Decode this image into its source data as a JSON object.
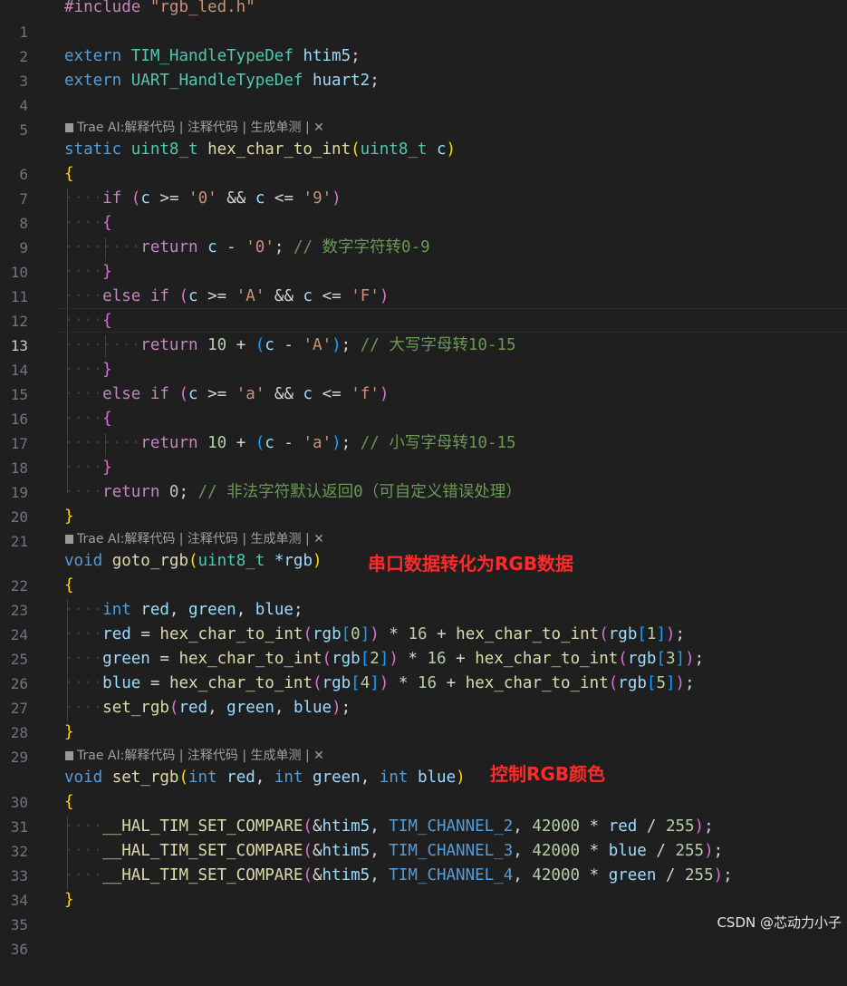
{
  "editor": {
    "theme_background": "#1f1f1f",
    "active_line": 13,
    "code_lens": "Trae AI:解释代码 | 注释代码 | 生成单测 | ✕",
    "line_numbers": [
      "1",
      "2",
      "3",
      "4",
      "5",
      "6",
      "7",
      "8",
      "9",
      "10",
      "11",
      "12",
      "13",
      "14",
      "15",
      "16",
      "17",
      "18",
      "19",
      "20",
      "21",
      "22",
      "23",
      "24",
      "25",
      "26",
      "27",
      "28",
      "29",
      "30",
      "31",
      "32",
      "33",
      "34",
      "35",
      "36"
    ]
  },
  "code": {
    "include_kw": "#include",
    "include_file": "\"rgb_led.h\"",
    "extern_kw": "extern",
    "tim_type": "TIM_HandleTypeDef",
    "htim5": "htim5",
    "uart_type": "UART_HandleTypeDef",
    "huart2": "huart2",
    "semicolon": ";",
    "static_kw": "static",
    "uint8_t": "uint8_t",
    "hex_fn": "hex_char_to_int",
    "param_c": "c",
    "open_paren": "(",
    "close_paren": ")",
    "open_brace": "{",
    "close_brace": "}",
    "if_kw": "if",
    "else_kw": "else",
    "return_kw": "return",
    "ge": ">=",
    "le": "<=",
    "and": "&&",
    "minus": "-",
    "plus": "+",
    "times": "*",
    "divide": "/",
    "assign": "=",
    "comma": ",",
    "ampersand": "&",
    "ch_0": "'0'",
    "ch_9": "'9'",
    "ch_A": "'A'",
    "ch_F": "'F'",
    "ch_a": "'a'",
    "ch_f": "'f'",
    "num_10": "10",
    "num_0": "0",
    "num_16": "16",
    "num_42000": "42000",
    "num_255": "255",
    "cm_digit": "// 数字字符转0-9",
    "cm_upper": "// 大写字母转10-15",
    "cm_lower": "// 小写字母转10-15",
    "cm_invalid": "// 非法字符默认返回0（可自定义错误处理）",
    "void_kw": "void",
    "goto_rgb": "goto_rgb",
    "star_rgb": "*rgb",
    "int_kw": "int",
    "red": "red",
    "green": "green",
    "blue": "blue",
    "rgb": "rgb",
    "lb": "[",
    "rb": "]",
    "idx_0": "0",
    "idx_1": "1",
    "idx_2": "2",
    "idx_3": "3",
    "idx_4": "4",
    "idx_5": "5",
    "set_rgb": "set_rgb",
    "hal_macro": "__HAL_TIM_SET_COMPARE",
    "ch2": "TIM_CHANNEL_2",
    "ch3": "TIM_CHANNEL_3",
    "ch4": "TIM_CHANNEL_4"
  },
  "annotations": {
    "goto_rgb_note": "串口数据转化为RGB数据",
    "set_rgb_note": "控制RGB颜色",
    "note_color": "#ff2a2a"
  },
  "watermark": "CSDN @芯动力小子"
}
